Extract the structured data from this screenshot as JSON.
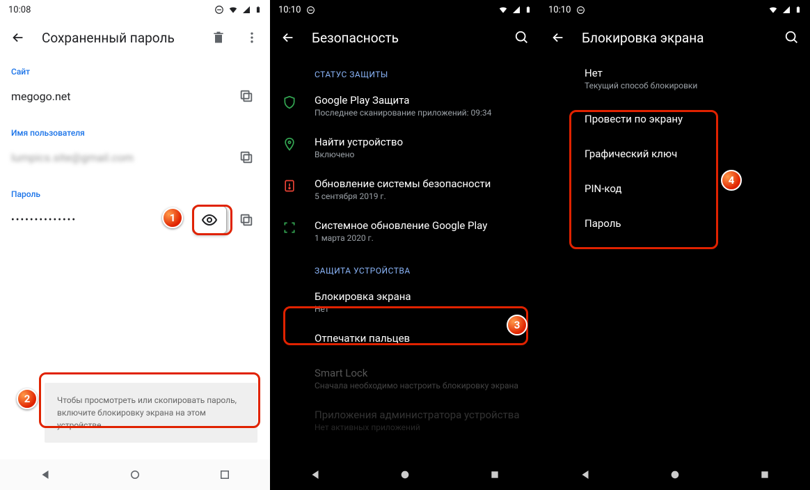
{
  "phone1": {
    "time": "10:08",
    "title": "Сохраненный пароль",
    "site_label": "Сайт",
    "site_value": "megogo.net",
    "user_label": "Имя пользователя",
    "user_value": "lumpics.site@gmail.com",
    "pass_label": "Пароль",
    "pass_value": "••••••••••••••",
    "toast": "Чтобы просмотреть или скопировать пароль, включите блокировку экрана на этом устройстве."
  },
  "phone2": {
    "time": "10:10",
    "title": "Безопасность",
    "section1": "СТАТУС ЗАЩИТЫ",
    "items1": [
      {
        "title": "Google Play Защита",
        "sub": "Последнее сканирование приложений: 09:34"
      },
      {
        "title": "Найти устройство",
        "sub": "Включено"
      },
      {
        "title": "Обновление системы безопасности",
        "sub": "5 сентября 2019 г."
      },
      {
        "title": "Системное обновление Google Play",
        "sub": "1 марта 2020 г."
      }
    ],
    "section2": "ЗАЩИТА УСТРОЙСТВА",
    "items2": [
      {
        "title": "Блокировка экрана",
        "sub": "Нет"
      },
      {
        "title": "Отпечатки пальцев",
        "sub": ""
      },
      {
        "title": "Smart Lock",
        "sub": "Сначала необходимо настроить блокировку экрана"
      },
      {
        "title": "Приложения администратора устройства",
        "sub": "Нет активных приложений"
      }
    ]
  },
  "phone3": {
    "time": "10:10",
    "title": "Блокировка экрана",
    "current": {
      "title": "Нет",
      "sub": "Текущий способ блокировки"
    },
    "options": [
      "Провести по экрану",
      "Графический ключ",
      "PIN-код",
      "Пароль"
    ]
  },
  "badges": {
    "b1": "1",
    "b2": "2",
    "b3": "3",
    "b4": "4"
  }
}
